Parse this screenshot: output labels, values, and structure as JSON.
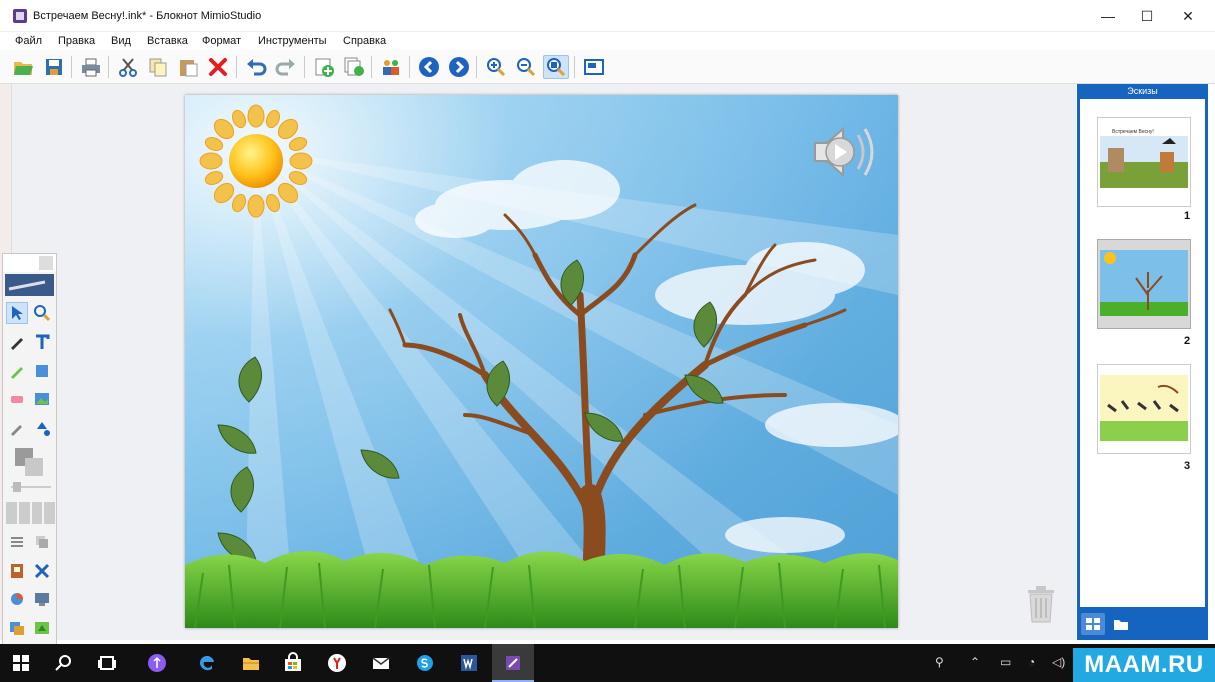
{
  "window": {
    "title": "Встречаем Весну!.ink* - Блокнот MimioStudio",
    "minimize": "—",
    "maximize": "☐",
    "close": "✕"
  },
  "menu": [
    "Файл",
    "Правка",
    "Вид",
    "Вставка",
    "Формат",
    "Инструменты",
    "Справка"
  ],
  "toolbar": {
    "icons": [
      "open-icon",
      "save-icon",
      "print-icon",
      "cut-icon",
      "copy-icon",
      "paste-icon",
      "delete-icon",
      "undo-icon",
      "redo-icon",
      "new-page-icon",
      "duplicate-page-icon",
      "collaborate-icon",
      "previous-page-icon",
      "next-page-icon",
      "zoom-in-icon",
      "zoom-out-icon",
      "zoom-fit-icon",
      "fit-page-icon"
    ],
    "active": "zoom-fit-icon"
  },
  "thumbnails": {
    "header": "Эскизы",
    "pages": [
      {
        "number": "1",
        "caption": "Встречаем Весну!"
      },
      {
        "number": "2",
        "caption": ""
      },
      {
        "number": "3",
        "caption": ""
      }
    ],
    "selected_page": "2"
  },
  "palette": {
    "selected_tool": "select-tool"
  },
  "taskbar": {
    "pinned": [
      "start-icon",
      "search-icon",
      "task-view-icon",
      "cortana-icon",
      "edge-icon",
      "file-explorer-icon",
      "store-icon",
      "yandex-icon",
      "mail-icon",
      "skype-icon",
      "word-icon",
      "mimio-icon"
    ],
    "active": "mimio-icon"
  },
  "watermark": "MAAM.RU",
  "colors": {
    "accent": "#1565c0",
    "sky": "#6fb8e8",
    "grass": "#4caf2a",
    "watermark": "#23a9e1"
  }
}
